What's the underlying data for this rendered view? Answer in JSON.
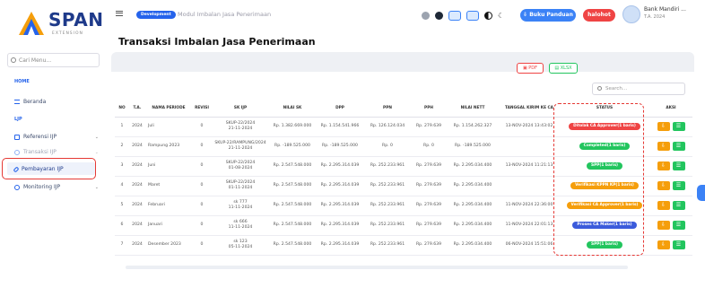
{
  "logo": {
    "text": "SPAN",
    "sub": "EXTENSION"
  },
  "sidebar": {
    "search_placeholder": "Cari Menu...",
    "sections": [
      {
        "label": "HOME"
      },
      {
        "label": "LJP"
      }
    ],
    "items": [
      {
        "label": "Beranda"
      },
      {
        "label": "Referensi IJP"
      },
      {
        "label": "Transaksi IJP"
      },
      {
        "label": "Pembayaran IJP"
      },
      {
        "label": "Monitoring IJP"
      }
    ]
  },
  "topbar": {
    "badge": "Development",
    "title": "Modul Imbalan Jasa Penerimaan",
    "panduan_label": "Buku Panduan",
    "halo_label": "halohot",
    "user_name": "Bank Mandiri ...",
    "user_year": "T.A. 2024"
  },
  "page": {
    "title": "Transaksi Imbalan Jasa Penerimaan"
  },
  "toolbar": {
    "pdf_label": "PDF",
    "xlsx_label": "XLSX",
    "search_placeholder": "Search..."
  },
  "table": {
    "headers": [
      "NO",
      "T.A.",
      "NAMA PERIODE",
      "REVISI",
      "SK IJP",
      "NILAI SK",
      "DPP",
      "PPN",
      "PPH",
      "NILAI NETT",
      "TANGGAL KIRIM KE CA",
      "STATUS",
      "AKSI"
    ],
    "rows": [
      {
        "no": "1",
        "ta": "2024",
        "periode": "Juli",
        "revisi": "0",
        "sk": "SKUP-22/2024",
        "sk_date": "21-11-2024",
        "nilai_sk": "Rp. 1.382.669.000",
        "dpp": "Rp. 1.154.541.966",
        "ppn": "Rp. 126.124.034",
        "pph": "Rp. 279.639",
        "nett": "Rp. 1.154.262.327",
        "tanggal": "13-NOV-2024 13:43:02",
        "status": "Ditolak CA Approver(1 baris)",
        "status_color": "#ef4444"
      },
      {
        "no": "2",
        "ta": "2024",
        "periode": "Rampung 2023",
        "revisi": "0",
        "sk": "SKUP-22/RAMPUNG/2024",
        "sk_date": "21-11-2024",
        "nilai_sk": "Rp. -189.525.000",
        "dpp": "Rp. -189.525.000",
        "ppn": "Rp. 0",
        "pph": "Rp. 0",
        "nett": "Rp. -189.525.000",
        "tanggal": "",
        "status": "Completed(1 baris)",
        "status_color": "#22c55e"
      },
      {
        "no": "3",
        "ta": "2024",
        "periode": "Juni",
        "revisi": "0",
        "sk": "SKUP-22/2024",
        "sk_date": "01-08-2024",
        "nilai_sk": "Rp. 2.547.548.000",
        "dpp": "Rp. 2.295.314.039",
        "ppn": "Rp. 252.233.961",
        "pph": "Rp. 279.639",
        "nett": "Rp. 2.295.034.400",
        "tanggal": "13-NOV-2024 11:21:13",
        "status": "SPP(1 baris)",
        "status_color": "#22c55e"
      },
      {
        "no": "4",
        "ta": "2024",
        "periode": "Maret",
        "revisi": "0",
        "sk": "SKUP-22/2024",
        "sk_date": "01-11-2024",
        "nilai_sk": "Rp. 2.547.548.000",
        "dpp": "Rp. 2.295.314.039",
        "ppn": "Rp. 252.233.961",
        "pph": "Rp. 279.639",
        "nett": "Rp. 2.295.034.400",
        "tanggal": "",
        "status": "Verifikasi KPPN KP(1 baris)",
        "status_color": "#f59e0b"
      },
      {
        "no": "5",
        "ta": "2024",
        "periode": "Februari",
        "revisi": "0",
        "sk": "sk 777",
        "sk_date": "11-11-2024",
        "nilai_sk": "Rp. 2.547.548.000",
        "dpp": "Rp. 2.295.314.039",
        "ppn": "Rp. 252.233.961",
        "pph": "Rp. 279.639",
        "nett": "Rp. 2.295.034.400",
        "tanggal": "11-NOV-2024 22:36:00",
        "status": "Verifikasi CA Approver(1 baris)",
        "status_color": "#f59e0b"
      },
      {
        "no": "6",
        "ta": "2024",
        "periode": "Januari",
        "revisi": "0",
        "sk": "sk 666",
        "sk_date": "11-11-2024",
        "nilai_sk": "Rp. 2.547.548.000",
        "dpp": "Rp. 2.295.314.039",
        "ppn": "Rp. 252.233.961",
        "pph": "Rp. 279.639",
        "nett": "Rp. 2.295.034.400",
        "tanggal": "11-NOV-2024 22:01:13",
        "status": "Proses CA Maker(1 baris)",
        "status_color": "#3b5bdb"
      },
      {
        "no": "7",
        "ta": "2024",
        "periode": "Desember 2023",
        "revisi": "0",
        "sk": "sk 123",
        "sk_date": "05-11-2024",
        "nilai_sk": "Rp. 2.547.548.000",
        "dpp": "Rp. 2.295.314.039",
        "ppn": "Rp. 252.233.961",
        "pph": "Rp. 279.639",
        "nett": "Rp. 2.295.034.400",
        "tanggal": "06-NOV-2024 15:51:06",
        "status": "SPP(1 baris)",
        "status_color": "#22c55e"
      }
    ]
  },
  "colors": {
    "accent": "#2563eb",
    "danger": "#ef4444",
    "success": "#22c55e",
    "warning": "#f59e0b",
    "aksi_upload": "#f59e0b",
    "aksi_list": "#22c55e"
  }
}
